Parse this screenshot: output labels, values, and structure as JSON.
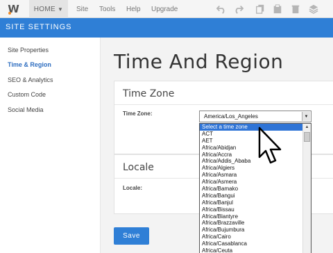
{
  "topbar": {
    "logo_letter": "W",
    "home_label": "HOME",
    "links": [
      "Site",
      "Tools",
      "Help",
      "Upgrade"
    ],
    "icons": [
      "undo-icon",
      "redo-icon",
      "copy-icon",
      "paste-icon",
      "trash-icon",
      "layers-icon"
    ]
  },
  "header": {
    "title": "SITE SETTINGS"
  },
  "sidebar": {
    "items": [
      {
        "label": "Site Properties",
        "active": false
      },
      {
        "label": "Time & Region",
        "active": true
      },
      {
        "label": "SEO & Analytics",
        "active": false
      },
      {
        "label": "Custom Code",
        "active": false
      },
      {
        "label": "Social Media",
        "active": false
      }
    ]
  },
  "main": {
    "title": "Time And Region",
    "timezone_section": {
      "heading": "Time Zone",
      "field_label": "Time Zone:",
      "selected_value": "America/Los_Angeles",
      "options": [
        "Select a time zone",
        "ACT",
        "AET",
        "Africa/Abidjan",
        "Africa/Accra",
        "Africa/Addis_Ababa",
        "Africa/Algiers",
        "Africa/Asmara",
        "Africa/Asmera",
        "Africa/Bamako",
        "Africa/Bangui",
        "Africa/Banjul",
        "Africa/Bissau",
        "Africa/Blantyre",
        "Africa/Brazzaville",
        "Africa/Bujumbura",
        "Africa/Cairo",
        "Africa/Casablanca",
        "Africa/Ceuta"
      ],
      "highlighted_index": 0
    },
    "locale_section": {
      "heading": "Locale",
      "field_label": "Locale:"
    },
    "save_label": "Save"
  },
  "colors": {
    "accent": "#2f7fd6",
    "selection": "#2f74d6",
    "active_nav": "#2f6ec0"
  }
}
